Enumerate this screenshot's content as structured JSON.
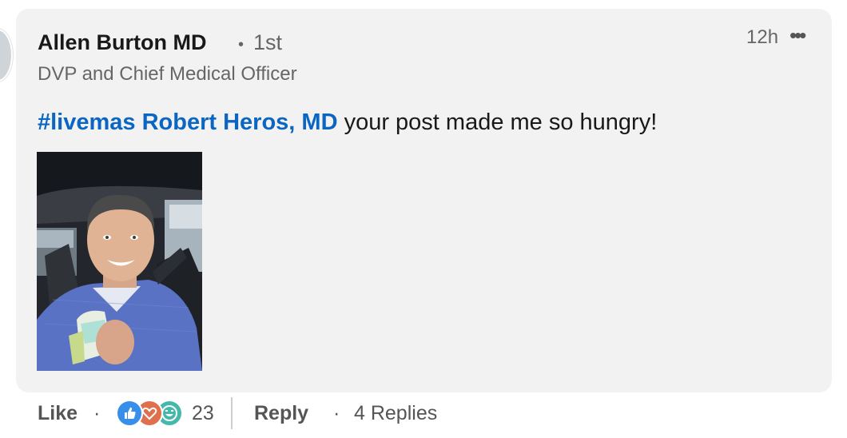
{
  "comment": {
    "author": "Allen Burton MD",
    "separator": "•",
    "degree": "1st",
    "headline": "DVP and Chief Medical Officer",
    "timestamp": "12h",
    "more_label": "•••",
    "mention_text": "#livemas Robert Heros, MD",
    "body_text": " your post made me so hungry!",
    "image": "selfie-in-car-holding-burrito",
    "mention_color": "#0a66c2"
  },
  "footer": {
    "like_label": "Like",
    "dot": "·",
    "reaction_icons": [
      "like-icon",
      "love-icon",
      "funny-icon"
    ],
    "reaction_count": "23",
    "reply_label": "Reply",
    "replies_label": "4 Replies"
  }
}
